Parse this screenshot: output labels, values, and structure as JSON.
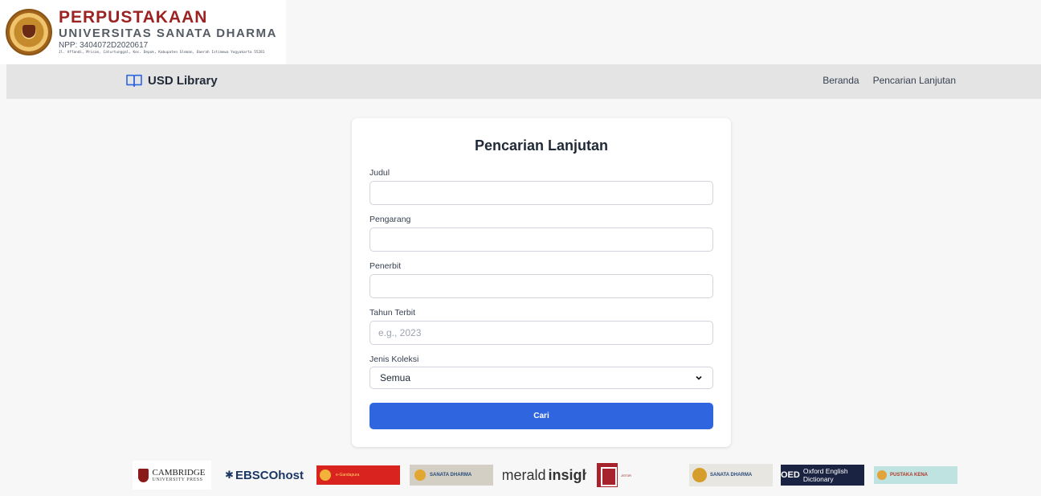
{
  "banner": {
    "title": "PERPUSTAKAAN",
    "subtitle": "UNIVERSITAS SANATA DHARMA",
    "npp": "NPP: 3404072D2020617",
    "address": "Jl. Affandi, Mrican, Caturtunggal, Kec. Depok, Kabupaten Sleman, Daerah Istimewa Yogyakarta 55281"
  },
  "navbar": {
    "brand": "USD Library",
    "links": [
      "Beranda",
      "Pencarian Lanjutan"
    ]
  },
  "form": {
    "title": "Pencarian Lanjutan",
    "fields": {
      "judul": {
        "label": "Judul",
        "value": "",
        "placeholder": ""
      },
      "pengarang": {
        "label": "Pengarang",
        "value": "",
        "placeholder": ""
      },
      "penerbit": {
        "label": "Penerbit",
        "value": "",
        "placeholder": ""
      },
      "tahun": {
        "label": "Tahun Terbit",
        "value": "",
        "placeholder": "e.g., 2023"
      },
      "jenis": {
        "label": "Jenis Koleksi",
        "selected": "Semua"
      }
    },
    "submit_label": "Cari"
  },
  "partners": {
    "cambridge": {
      "line1": "CAMBRIDGE",
      "line2": "UNIVERSITY PRESS"
    },
    "ebsco": "EBSCOhost",
    "ojs": "e-Gandapura",
    "ejournal": "SANATA DHARMA",
    "emerald": {
      "part1": "emerald",
      "part2": "insight"
    },
    "jstor": "JSTOR",
    "usdlib": "SANATA DHARMA",
    "oed": {
      "abbr": "OED",
      "name": "Oxford English Dictionary"
    },
    "pustaka": "PUSTAKA KENA"
  }
}
